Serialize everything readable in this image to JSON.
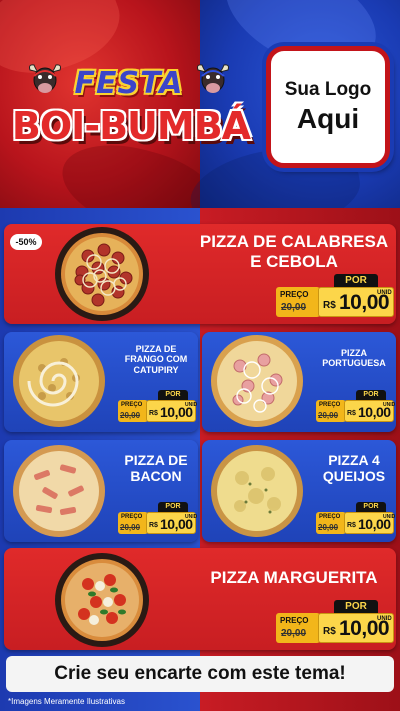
{
  "header": {
    "title_line1": "FESTA",
    "title_line2": "BOI-BUMBÁ",
    "logo_line1": "Sua Logo",
    "logo_line2": "Aqui"
  },
  "badge": "-50%",
  "items": [
    {
      "name": "PIZZA DE CALABRESA E CEBOLA",
      "por": "POR",
      "preco": "PREÇO",
      "old": "20,00",
      "currency": "R$",
      "price": "10,00",
      "unit": "UNID"
    },
    {
      "name": "PIZZA DE FRANGO COM CATUPIRY",
      "por": "POR",
      "preco": "PREÇO",
      "old": "20,00",
      "currency": "R$",
      "price": "10,00",
      "unit": "UNID"
    },
    {
      "name": "PIZZA PORTUGUESA",
      "por": "POR",
      "preco": "PREÇO",
      "old": "20,00",
      "currency": "R$",
      "price": "10,00",
      "unit": "UNID"
    },
    {
      "name": "PIZZA DE BACON",
      "por": "POR",
      "preco": "PREÇO",
      "old": "20,00",
      "currency": "R$",
      "price": "10,00",
      "unit": "UNID"
    },
    {
      "name": "PIZZA 4 QUEIJOS",
      "por": "POR",
      "preco": "PREÇO",
      "old": "20,00",
      "currency": "R$",
      "price": "10,00",
      "unit": "UNID"
    },
    {
      "name": "PIZZA MARGUERITA",
      "por": "POR",
      "preco": "PREÇO",
      "old": "20,00",
      "currency": "R$",
      "price": "10,00",
      "unit": "UNID"
    }
  ],
  "footer": {
    "cta": "Crie seu encarte com este tema!",
    "note": "*Imagens Meramente Ilustrativas"
  },
  "colors": {
    "red": "#c81e22",
    "blue": "#1f43b8",
    "gold": "#fcd64a"
  }
}
